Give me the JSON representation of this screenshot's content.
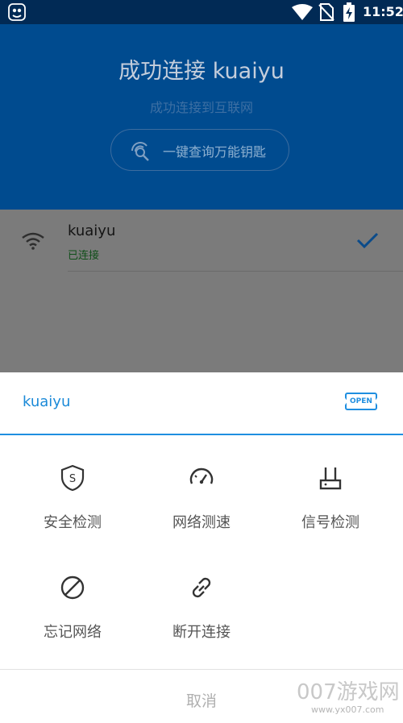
{
  "status_bar": {
    "time": "11:52",
    "icons": [
      "app-notification-icon",
      "wifi-icon",
      "no-sim-signal-icon",
      "battery-charging-icon"
    ]
  },
  "header": {
    "title": "成功连接 kuaiyu",
    "subtitle": "成功连接到互联网",
    "query_button_label": "一键查询万能钥匙",
    "query_icon": "key-search-icon",
    "background_color": "#004b8f"
  },
  "network": {
    "ssid": "kuaiyu",
    "state": "已连接",
    "icon": "wifi-icon",
    "selected_icon": "check-icon"
  },
  "sheet": {
    "ssid": "kuaiyu",
    "security_badge": "OPEN",
    "accent_color": "#1f8ee0",
    "actions": [
      {
        "label": "安全检测",
        "icon": "shield-s-icon"
      },
      {
        "label": "网络测速",
        "icon": "speedometer-icon"
      },
      {
        "label": "信号检测",
        "icon": "router-icon"
      },
      {
        "label": "忘记网络",
        "icon": "block-icon"
      },
      {
        "label": "断开连接",
        "icon": "broken-link-icon"
      }
    ],
    "cancel_label": "取消"
  },
  "watermark": {
    "main": "007游戏网",
    "url": "www.yx007.com"
  }
}
